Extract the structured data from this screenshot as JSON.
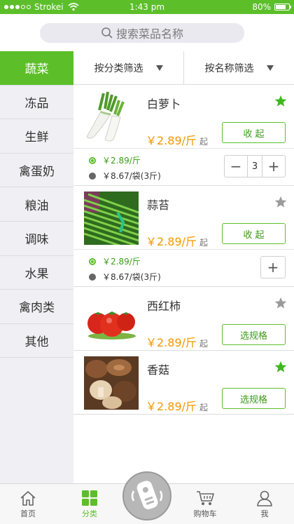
{
  "status_bar": {
    "carrier": "Strokei",
    "time": "1:43 pm",
    "battery": "80%",
    "battery_level": 0.8
  },
  "search": {
    "placeholder": "搜索菜品名称"
  },
  "sidebar": {
    "items": [
      {
        "label": "蔬菜",
        "active": true
      },
      {
        "label": "冻品"
      },
      {
        "label": "生鲜"
      },
      {
        "label": "禽蛋奶"
      },
      {
        "label": "粮油"
      },
      {
        "label": "调味"
      },
      {
        "label": "水果"
      },
      {
        "label": "禽肉类"
      },
      {
        "label": "其他"
      }
    ]
  },
  "filters": {
    "by_category": "按分类筛选",
    "by_name": "按名称筛选"
  },
  "products": [
    {
      "name": "白萝卜",
      "price": "￥2.89/斤",
      "suffix": "起",
      "button": "收 起",
      "starred": true,
      "specs": [
        {
          "label": "￥2.89/斤",
          "selected": true
        },
        {
          "label": "￥8.67/袋(3斤)",
          "selected": false
        }
      ],
      "quantity": "3"
    },
    {
      "name": "蒜苔",
      "price": "￥2.89/斤",
      "suffix": "起",
      "button": "收 起",
      "starred": false,
      "specs": [
        {
          "label": "￥2.89/斤",
          "selected": true
        },
        {
          "label": "￥8.67/袋(3斤)",
          "selected": false
        }
      ]
    },
    {
      "name": "西红柿",
      "price": "￥2.89/斤",
      "suffix": "起",
      "button": "选规格",
      "starred": false
    },
    {
      "name": "香菇",
      "price": "￥2.89/斤",
      "suffix": "起",
      "button": "选规格",
      "starred": true
    }
  ],
  "tabbar": {
    "home": "首页",
    "category": "分类",
    "cart": "购物车",
    "me": "我"
  },
  "colors": {
    "brand": "#5cbf2a",
    "price": "#f39800",
    "star_on": "#3db81e",
    "star_off": "#9b9b9b"
  },
  "icons": [
    "search-icon",
    "wifi-icon",
    "dropdown-triangle-icon",
    "star-icon",
    "home-icon",
    "category-grid-icon",
    "voice-order-icon",
    "cart-icon",
    "user-icon"
  ]
}
